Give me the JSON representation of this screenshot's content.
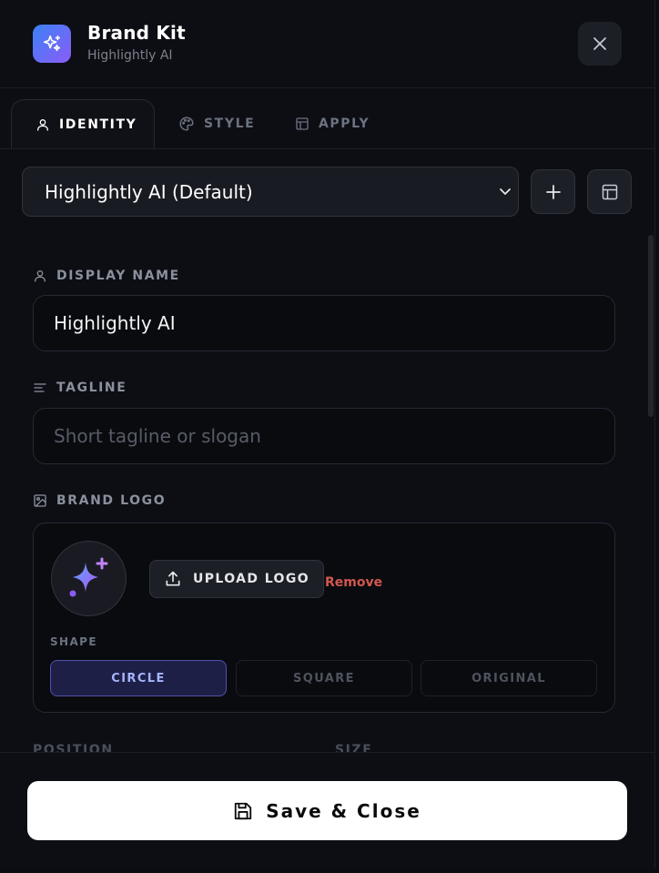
{
  "header": {
    "title": "Brand Kit",
    "subtitle": "Highlightly AI",
    "app_icon": "sparkles-icon",
    "close_icon": "close-icon"
  },
  "tabs": [
    {
      "label": "IDENTITY",
      "icon": "user-icon",
      "active": true
    },
    {
      "label": "STYLE",
      "icon": "palette-icon",
      "active": false
    },
    {
      "label": "APPLY",
      "icon": "layout-icon",
      "active": false
    }
  ],
  "kit_selector": {
    "selected": "Highlightly AI (Default)",
    "add_icon": "plus-icon",
    "templates_icon": "layout-icon"
  },
  "identity": {
    "display_name": {
      "label": "DISPLAY NAME",
      "value": "Highlightly AI",
      "icon": "user-icon"
    },
    "tagline": {
      "label": "TAGLINE",
      "value": "",
      "placeholder": "Short tagline or slogan",
      "icon": "align-left-icon"
    },
    "brand_logo": {
      "label": "BRAND LOGO",
      "icon": "image-icon",
      "upload_label": "UPLOAD LOGO",
      "remove_label": "Remove",
      "shape_label": "SHAPE",
      "shapes": [
        {
          "label": "CIRCLE",
          "active": true
        },
        {
          "label": "SQUARE",
          "active": false
        },
        {
          "label": "ORIGINAL",
          "active": false
        }
      ]
    },
    "position_label": "POSITION",
    "size_label": "SIZE"
  },
  "footer": {
    "save_label": "Save & Close",
    "save_icon": "save-icon"
  },
  "colors": {
    "background": "#0d0e14",
    "accent_gradient_start": "#3b82f6",
    "accent_gradient_end": "#8b5cf6",
    "active_shape_bg": "#1e1f46",
    "active_shape_text": "#a5b4fc",
    "danger": "#d1574f",
    "primary_button": "#ffffff"
  }
}
